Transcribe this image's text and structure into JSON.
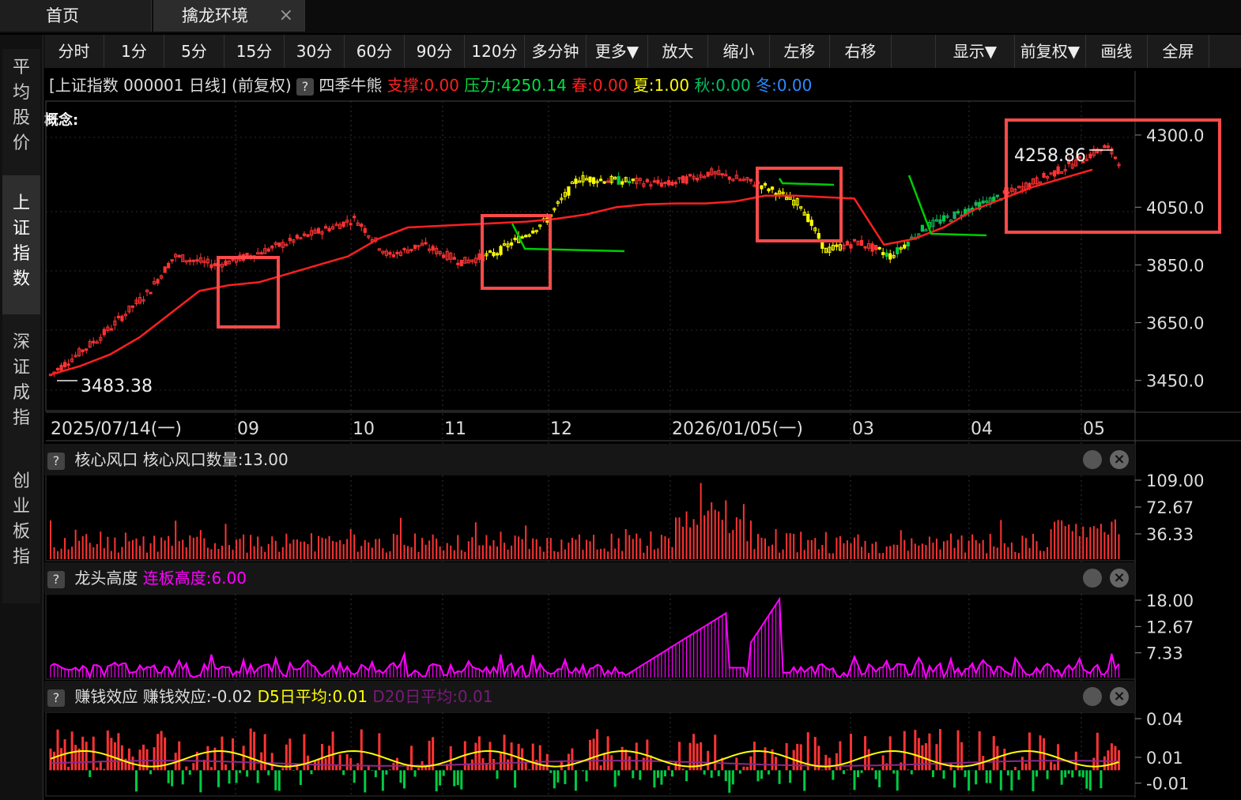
{
  "tabs": [
    {
      "label": "首页",
      "active": false
    },
    {
      "label": "擒龙环境",
      "active": true,
      "close_icon": "×"
    }
  ],
  "toolbar": [
    "分时",
    "1分",
    "5分",
    "15分",
    "30分",
    "60分",
    "90分",
    "120分",
    "多分钟",
    "更多▼",
    "放大",
    "缩小",
    "左移",
    "右移",
    "",
    "显示▼",
    "前复权▼",
    "画线",
    "全屏"
  ],
  "sidebar": [
    {
      "label": "平均股价",
      "active": false
    },
    {
      "label": "上证指数",
      "active": true
    },
    {
      "label": "深证成指",
      "active": false
    },
    {
      "label": "创业板指",
      "active": false
    }
  ],
  "info": {
    "title": "[上证指数 000001 日线]",
    "adjust": "(前复权)",
    "q": "?",
    "indicator": "四季牛熊",
    "support": "支撑:0.00",
    "pressure": "压力:4250.14",
    "spring": "春:0.00",
    "summer": "夏:1.00",
    "autumn": "秋:0.00",
    "winter": "冬:0.00"
  },
  "concept_label": "概念:",
  "annotations": {
    "high": "4258.86",
    "low": "3483.38"
  },
  "colors": {
    "up": "#ff3333",
    "down": "#00cc44",
    "support": "#ff2020",
    "pressure": "#00cc00",
    "summer": "#ffff00",
    "magenta": "#ff00ff",
    "highlight": "#ff4a4a"
  },
  "panels": [
    {
      "q": "?",
      "name": "核心风口",
      "value": "核心风口数量:13.00"
    },
    {
      "q": "?",
      "name": "龙头高度",
      "value": "连板高度:6.00"
    },
    {
      "q": "?",
      "name": "赚钱效应",
      "value": "赚钱效应:-0.02",
      "d5": "D5日平均:0.01",
      "d20": "D20日平均:0.01"
    }
  ],
  "chart_data": [
    {
      "type": "candlestick",
      "title": "上证指数 000001 日线",
      "y_ticks": [
        "4300.0",
        "4050.0",
        "3850.0",
        "3650.0",
        "3450.0"
      ],
      "ylim": [
        3400,
        4330
      ],
      "x_ticks": [
        "2025/07/14(一)",
        "09",
        "10",
        "11",
        "12",
        "2026/01/05(一)",
        "03",
        "04",
        "05"
      ],
      "series": [
        {
          "name": "支撑",
          "values": [
            3470,
            3500,
            3540,
            3600,
            3680,
            3760,
            3780,
            3790,
            3820,
            3850,
            3880,
            3940,
            3980,
            3985,
            3990,
            3995,
            4000,
            4010,
            4025,
            4050,
            4060,
            4063,
            4063,
            4070,
            4090,
            4090,
            4085,
            4080,
            3920,
            3940,
            3980,
            4040,
            4080,
            4120,
            4150,
            4180
          ]
        },
        {
          "name": "压力",
          "values": [
            4150,
            4040,
            4010,
            4000,
            3995,
            3990,
            3985,
            4130,
            4135,
            4140,
            4145,
            4165,
            4095,
            4090,
            4080,
            3995,
            3990,
            3985
          ]
        }
      ],
      "highlights": [
        "3870-3830",
        "3980-4000",
        "4140-4160",
        "4250-4300"
      ]
    },
    {
      "type": "bar",
      "title": "核心风口",
      "y_ticks": [
        "109.00",
        "72.67",
        "36.33"
      ],
      "ylim": [
        0,
        109
      ]
    },
    {
      "type": "bar",
      "title": "龙头高度",
      "y_ticks": [
        "18.00",
        "12.67",
        "7.33"
      ],
      "ylim": [
        2,
        18
      ]
    },
    {
      "type": "bar",
      "title": "赚钱效应",
      "y_ticks": [
        "0.04",
        "0.01",
        "-0.01"
      ],
      "ylim": [
        -0.02,
        0.04
      ]
    }
  ]
}
